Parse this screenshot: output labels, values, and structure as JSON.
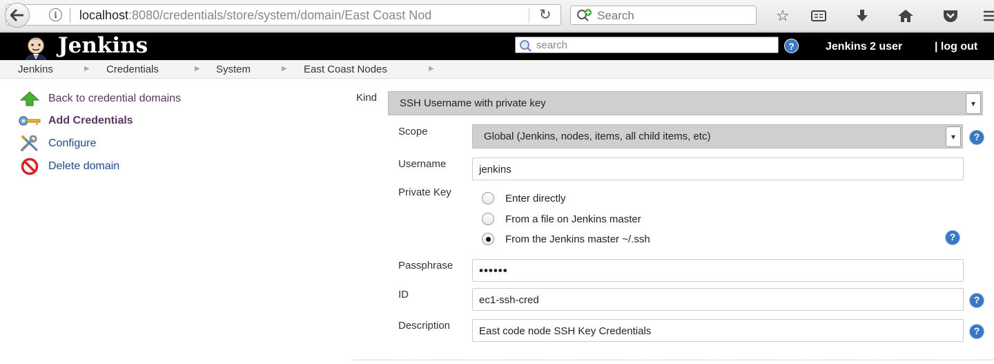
{
  "browser": {
    "url_host": "localhost",
    "url_rest": ":8080/credentials/store/system/domain/East Coast Nod",
    "search_placeholder": "Search"
  },
  "header": {
    "title": "Jenkins",
    "search_placeholder": "search",
    "help": "?",
    "user": "Jenkins 2 user",
    "logout": "| log out"
  },
  "breadcrumb": [
    "Jenkins",
    "Credentials",
    "System",
    "East Coast Nodes"
  ],
  "sidebar": {
    "items": [
      {
        "label": "Back to credential domains"
      },
      {
        "label": "Add Credentials"
      },
      {
        "label": "Configure"
      },
      {
        "label": "Delete domain"
      }
    ]
  },
  "form": {
    "kind": {
      "label": "Kind",
      "value": "SSH Username with private key"
    },
    "scope": {
      "label": "Scope",
      "value": "Global (Jenkins, nodes, items, all child items, etc)"
    },
    "username": {
      "label": "Username",
      "value": "jenkins"
    },
    "private_key": {
      "label": "Private Key",
      "options": [
        "Enter directly",
        "From a file on Jenkins master",
        "From the Jenkins master ~/.ssh"
      ],
      "selected": "From the Jenkins master ~/.ssh"
    },
    "passphrase": {
      "label": "Passphrase",
      "value": "••••••"
    },
    "id": {
      "label": "ID",
      "value": "ec1-ssh-cred"
    },
    "description": {
      "label": "Description",
      "value": "East code node SSH Key Credentials"
    }
  },
  "colors": {
    "header_bg": "#000000",
    "link": "#204a87",
    "visited_link": "#5c3566",
    "help_icon": "#3a78c3",
    "select_bg": "#cfcfcf"
  }
}
